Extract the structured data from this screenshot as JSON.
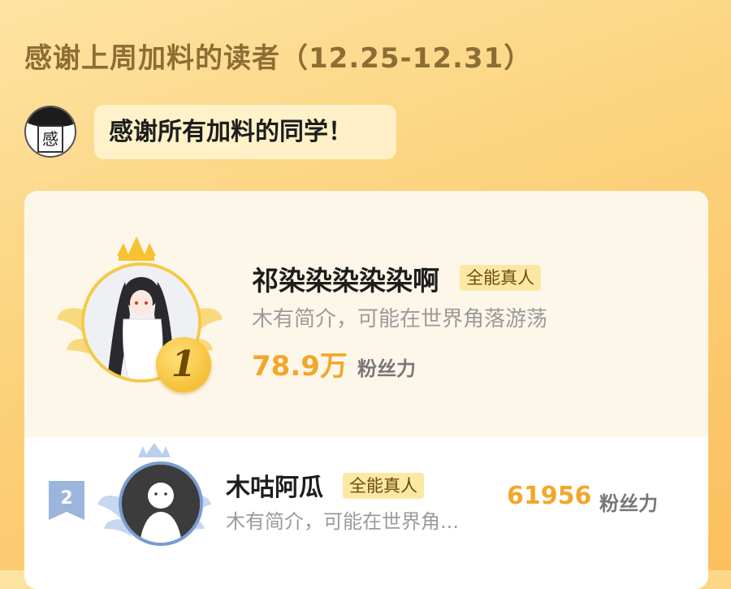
{
  "header": {
    "title": "感谢上周加料的读者（12.25-12.31）"
  },
  "author": {
    "avatar_char": "感",
    "message": "感谢所有加料的同学！"
  },
  "ranking": [
    {
      "rank": "1",
      "name": "祁染染染染染啊",
      "tag": "全能真人",
      "bio": "木有简介，可能在世界角落游荡",
      "fans_value": "78.9万",
      "fans_label": "粉丝力",
      "crown_icon": "crown-icon"
    },
    {
      "rank": "2",
      "name": "木咕阿瓜",
      "tag": "全能真人",
      "bio": "木有简介，可能在世界角...",
      "fans_value": "61956",
      "fans_label": "粉丝力"
    }
  ],
  "colors": {
    "background_start": "#fde4a2",
    "background_end": "#fbbf5e",
    "gold": "#f2a72b",
    "silver": "#7a9ccf"
  }
}
